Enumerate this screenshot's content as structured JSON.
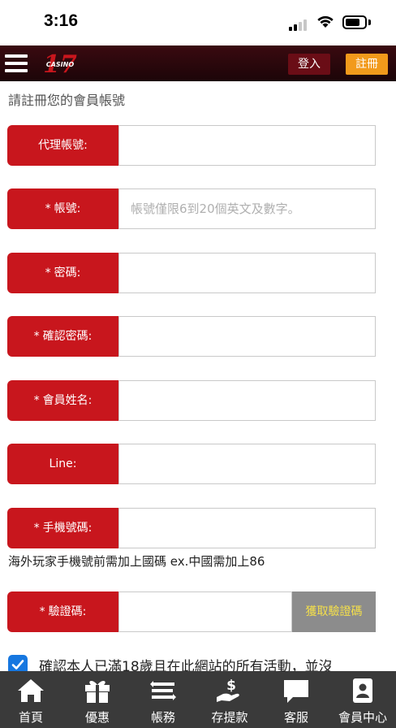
{
  "status_bar": {
    "time": "3:16"
  },
  "header": {
    "logo_text": "17",
    "logo_sub": "CASINO",
    "login_label": "登入",
    "register_label": "註冊"
  },
  "intro": "請註冊您的會員帳號",
  "form": {
    "agent": {
      "label": "代理帳號:",
      "value": ""
    },
    "account": {
      "label": "帳號:",
      "required": "*",
      "placeholder": "帳號僅限6到20個英文及數字。"
    },
    "password": {
      "label": "密碼:",
      "required": "*"
    },
    "confirm_password": {
      "label": "確認密碼:",
      "required": "*"
    },
    "name": {
      "label": "會員姓名:",
      "required": "*"
    },
    "line": {
      "label": "Line:"
    },
    "phone": {
      "label": "手機號碼:",
      "required": "*"
    },
    "phone_note": "海外玩家手機號前需加上國碼 ex.中國需加上86",
    "captcha": {
      "label": "驗證碼:",
      "required": "*",
      "button": "獲取驗證碼"
    },
    "agree_text": "確認本人已滿18歲且在此網站的所有活動，並沒",
    "agree_checked": true
  },
  "bottom_nav": [
    {
      "label": "首頁",
      "icon": "home-icon"
    },
    {
      "label": "優惠",
      "icon": "gift-icon"
    },
    {
      "label": "帳務",
      "icon": "transfer-icon"
    },
    {
      "label": "存提款",
      "icon": "deposit-icon"
    },
    {
      "label": "客服",
      "icon": "chat-icon"
    },
    {
      "label": "會員中心",
      "icon": "member-icon"
    }
  ],
  "colors": {
    "primary_red": "#c8161d",
    "header_dark": "#2a070c",
    "register_orange": "#f29a1b",
    "nav_bg": "#3a3a3a",
    "check_blue": "#1677e0"
  }
}
